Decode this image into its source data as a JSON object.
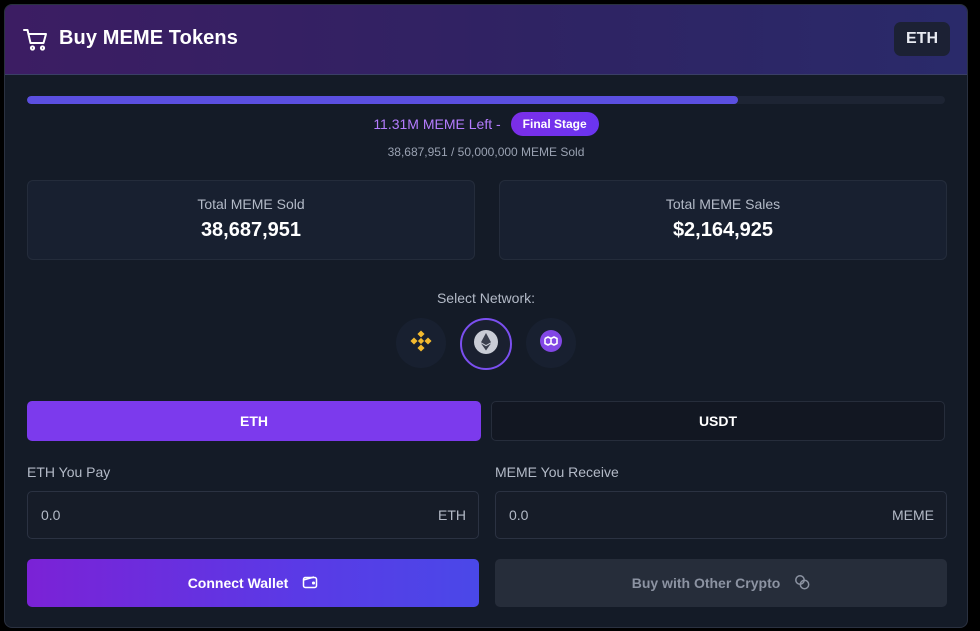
{
  "header": {
    "title": "Buy MEME Tokens",
    "currency_badge": "ETH",
    "colors": {
      "gradient_start": "#3c1d63",
      "gradient_end": "#2a2a6a"
    }
  },
  "progress": {
    "percent": 77.4,
    "remaining_text": "11.31M MEME Left -",
    "stage_label": "Final Stage",
    "sold_text": "38,687,951 / 50,000,000 MEME Sold"
  },
  "stats": {
    "sold_label": "Total MEME Sold",
    "sold_value": "38,687,951",
    "sales_label": "Total MEME Sales",
    "sales_value": "$2,164,925"
  },
  "network": {
    "label": "Select Network:",
    "options": [
      {
        "icon": "bnb-icon",
        "selected": false
      },
      {
        "icon": "ethereum-icon",
        "selected": true
      },
      {
        "icon": "polygon-icon",
        "selected": false
      }
    ]
  },
  "tabs": {
    "eth": "ETH",
    "usdt": "USDT",
    "active": "ETH"
  },
  "pay": {
    "label": "ETH You Pay",
    "value": "0.0",
    "unit": "ETH"
  },
  "receive": {
    "label": "MEME You Receive",
    "value": "0.0",
    "unit": "MEME"
  },
  "actions": {
    "connect": "Connect Wallet",
    "other": "Buy with Other Crypto"
  },
  "colors": {
    "accent": "#7c3aed",
    "progress": "#5b4fe0",
    "remaining_text": "#b57cff",
    "bnb": "#f3ba2f",
    "polygon": "#8247e5"
  }
}
